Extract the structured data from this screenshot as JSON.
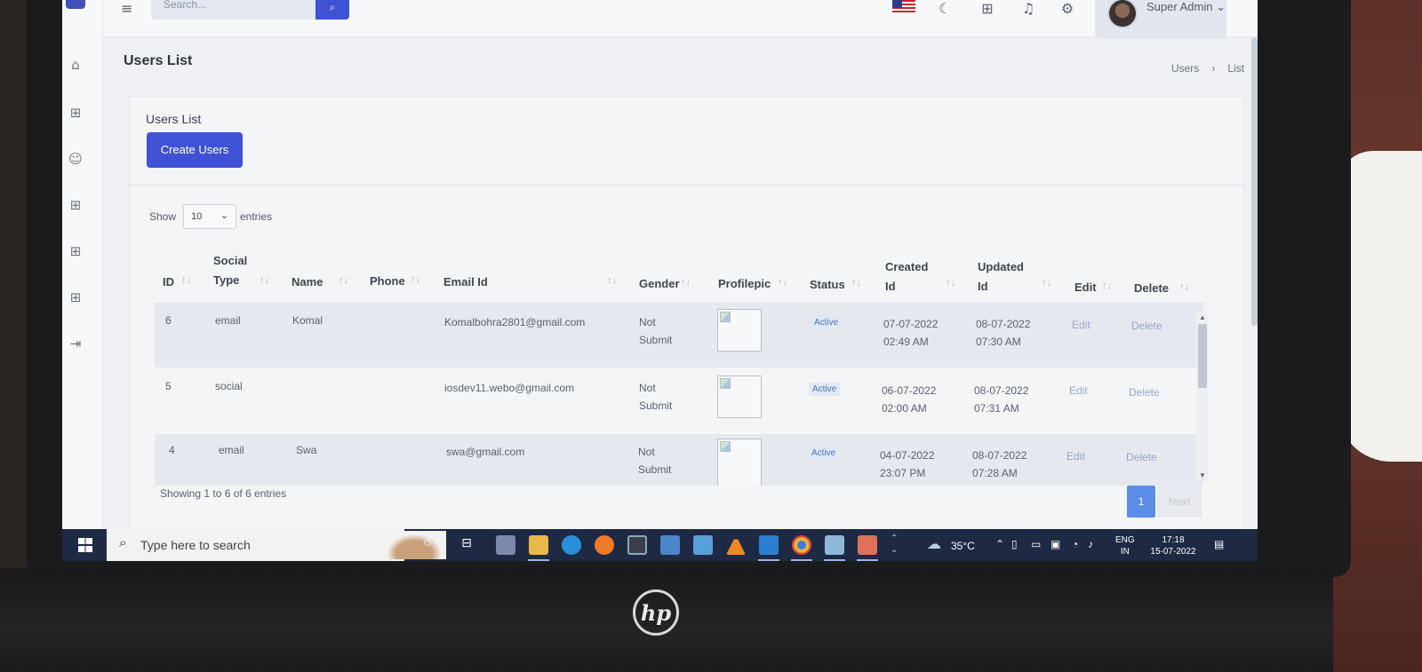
{
  "app": {
    "search_placeholder": "Search...",
    "user_name": "Super Admin",
    "page_title": "Users List",
    "breadcrumb": [
      "Users",
      "List"
    ]
  },
  "card": {
    "title": "Users List",
    "create_button": "Create Users",
    "show_label": "Show",
    "entries_value": "10",
    "entries_label": "entries",
    "footer_info": "Showing 1 to 6 of 6 entries",
    "current_page": "1",
    "next_label": "Next"
  },
  "table": {
    "headers": {
      "id": "ID",
      "social_type": [
        "Social",
        "Type"
      ],
      "name": "Name",
      "phone": "Phone",
      "email": "Email Id",
      "gender": "Gender",
      "profilepic": "Profilepic",
      "status": "Status",
      "created": [
        "Created",
        "Id"
      ],
      "updated": [
        "Updated",
        "Id"
      ],
      "edit": "Edit",
      "delete": "Delete"
    },
    "rows": [
      {
        "id": "6",
        "social_type": "email",
        "name": "Komal",
        "phone": "",
        "email": "Komalbohra2801@gmail.com",
        "gender": [
          "Not",
          "Submit"
        ],
        "status": "Active",
        "created": [
          "07-07-2022",
          "02:49 AM"
        ],
        "updated": [
          "08-07-2022",
          "07:30 AM"
        ],
        "edit": "Edit",
        "delete": "Delete"
      },
      {
        "id": "5",
        "social_type": "social",
        "name": "",
        "phone": "",
        "email": "iosdev11.webo@gmail.com",
        "gender": [
          "Not",
          "Submit"
        ],
        "status": "Active",
        "created": [
          "06-07-2022",
          "02:00 AM"
        ],
        "updated": [
          "08-07-2022",
          "07:31 AM"
        ],
        "edit": "Edit",
        "delete": "Delete"
      },
      {
        "id": "4",
        "social_type": "email",
        "name": "Swa",
        "phone": "",
        "email": "swa@gmail.com",
        "gender": [
          "Not",
          "Submit"
        ],
        "status": "Active",
        "created": [
          "04-07-2022",
          "23:07 PM"
        ],
        "updated": [
          "08-07-2022",
          "07:28 AM"
        ],
        "edit": "Edit",
        "delete": "Delete"
      }
    ]
  },
  "taskbar": {
    "search_text": "Type here to search",
    "weather": "35°C",
    "language": [
      "ENG",
      "IN"
    ],
    "time": "17:18",
    "date": "15-07-2022"
  },
  "icons": {
    "sidebar": [
      "home-icon",
      "grid-icon",
      "users-icon",
      "grid-icon",
      "grid-icon",
      "grid-icon",
      "logout-icon"
    ],
    "topbar": [
      "flag-us-icon",
      "moon-icon",
      "apps-grid-icon",
      "bell-icon",
      "gear-icon"
    ]
  },
  "colors": {
    "primary": "#3f51d4",
    "status_badge": "#4e74b8",
    "active_page": "#5b8de8"
  },
  "laptop_brand": "hp"
}
